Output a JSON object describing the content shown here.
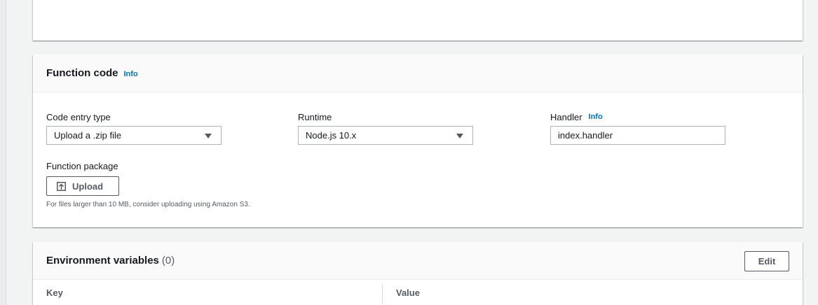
{
  "function_code": {
    "title": "Function code",
    "info": "Info",
    "code_entry_type": {
      "label": "Code entry type",
      "value": "Upload a .zip file"
    },
    "runtime": {
      "label": "Runtime",
      "value": "Node.js 10.x"
    },
    "handler": {
      "label": "Handler",
      "info": "Info",
      "value": "index.handler"
    },
    "function_package": {
      "label": "Function package",
      "upload_label": "Upload",
      "hint": "For files larger than 10 MB, consider uploading using Amazon S3."
    }
  },
  "environment_variables": {
    "title": "Environment variables",
    "count": "(0)",
    "edit_label": "Edit",
    "columns": [
      "Key",
      "Value"
    ]
  },
  "colors": {
    "link": "#0073bb",
    "text": "#16191f",
    "muted": "#545b64",
    "background": "#f2f3f3"
  }
}
